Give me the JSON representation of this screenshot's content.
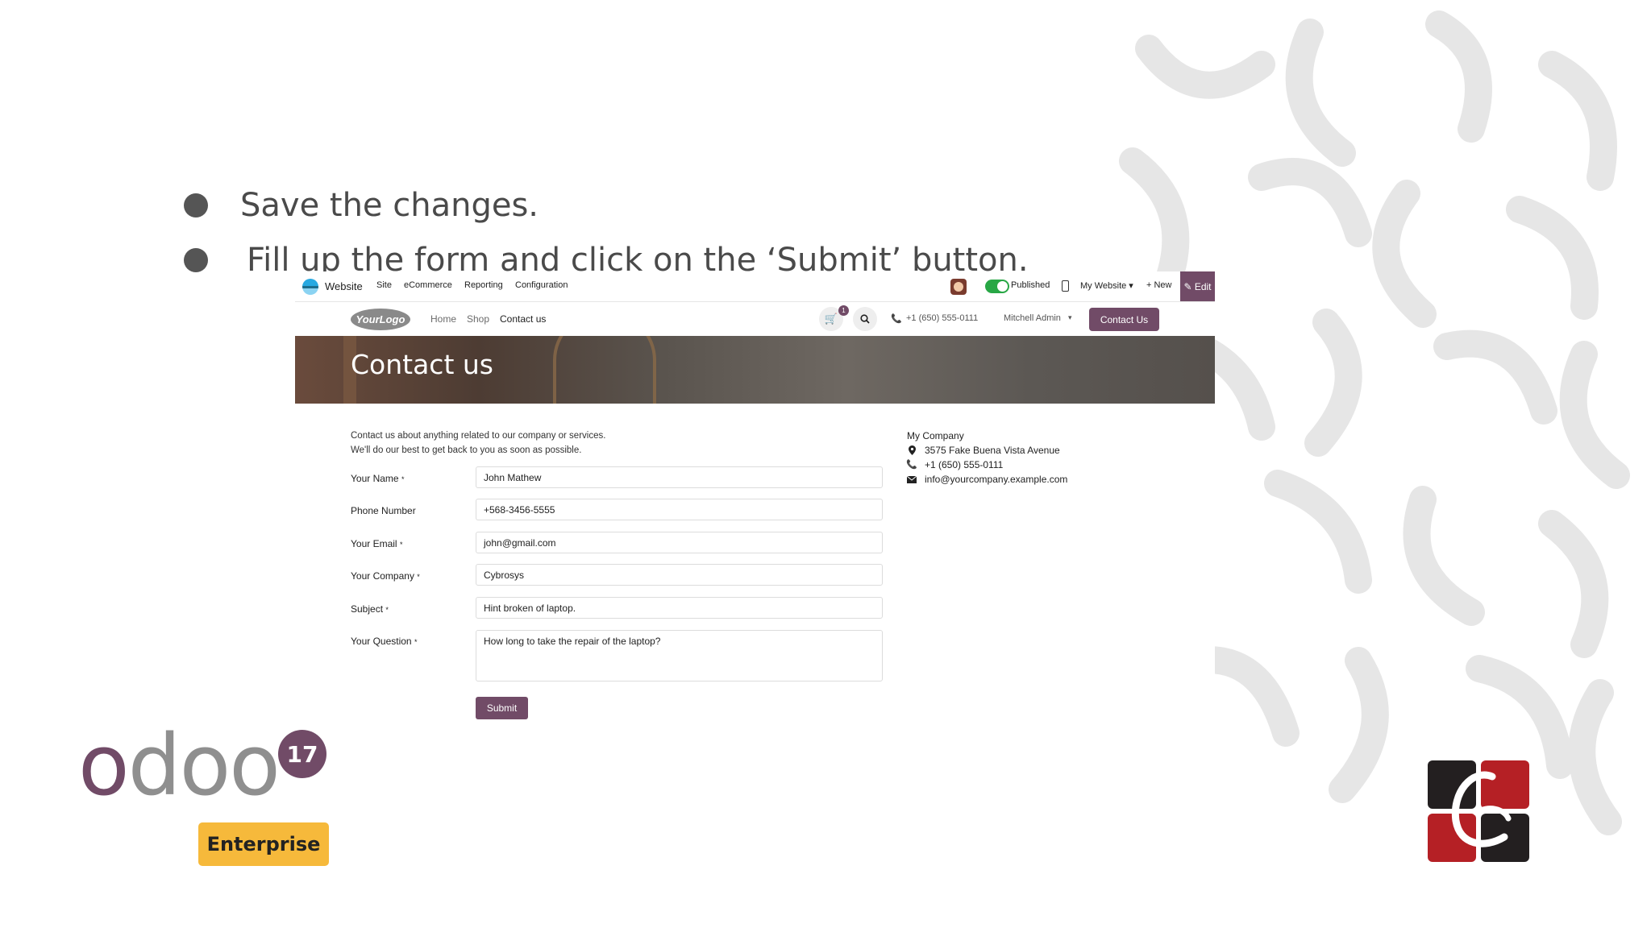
{
  "slide": {
    "bullets": [
      "Save the changes.",
      "Fill up the form and click on the ‘Submit’ button."
    ]
  },
  "adminbar": {
    "menu": [
      "Website",
      "Site",
      "eCommerce",
      "Reporting",
      "Configuration"
    ],
    "published_label": "Published",
    "website_selector": "My Website ▾",
    "new_label": "+ New",
    "edit_label": "✎ Edit"
  },
  "sitenav": {
    "logo_text": "YourLogo",
    "links": [
      "Home",
      "Shop",
      "Contact us"
    ],
    "cart_count": "1",
    "phone": "+1 (650) 555-0111",
    "user": "Mitchell Admin",
    "contact_button": "Contact Us"
  },
  "hero": {
    "title": "Contact us"
  },
  "form": {
    "intro_line1": "Contact us about anything related to our company or services.",
    "intro_line2": "We'll do our best to get back to you as soon as possible.",
    "fields": [
      {
        "label": "Your Name",
        "required": true,
        "value": "John Mathew"
      },
      {
        "label": "Phone Number",
        "required": false,
        "value": "+568-3456-5555"
      },
      {
        "label": "Your Email",
        "required": true,
        "value": "john@gmail.com"
      },
      {
        "label": "Your Company",
        "required": true,
        "value": "Cybrosys"
      },
      {
        "label": "Subject",
        "required": true,
        "value": "Hint broken of laptop."
      },
      {
        "label": "Your Question",
        "required": true,
        "value": "How long to take the repair of the laptop?"
      }
    ],
    "submit_label": "Submit"
  },
  "company": {
    "name": "My Company",
    "address": "3575 Fake Buena Vista Avenue",
    "phone": "+1 (650) 555-0111",
    "email": "info@yourcompany.example.com"
  },
  "branding": {
    "odoo_word": "odoo",
    "version": "17",
    "edition": "Enterprise",
    "colors": {
      "odoo_purple": "#714b67",
      "enterprise_yellow": "#f6b93b",
      "cybrosys_red": "#b52025"
    }
  }
}
